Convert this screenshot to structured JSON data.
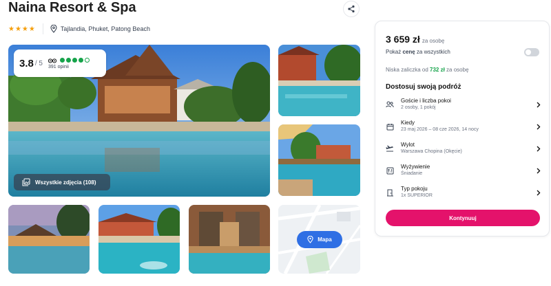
{
  "hotel": {
    "name": "Naina Resort & Spa",
    "stars": 4,
    "location": "Tajlandia, Phuket, Patong Beach"
  },
  "icons": {
    "share": "share-icon",
    "location": "map-pin-icon",
    "gallery": "gallery-icon",
    "map_pin": "map-pin-icon",
    "guests": "guests-icon",
    "calendar": "calendar-icon",
    "plane": "plane-icon",
    "food": "meal-icon",
    "room": "door-icon",
    "chevron": "chevron-right-icon"
  },
  "rating": {
    "score": "3.8",
    "of": "/ 5",
    "dots_filled": 4,
    "dots_total": 5,
    "reviews": "391 opinii"
  },
  "gallery": {
    "all_photos_label": "Wszystkie zdjęcia (108)",
    "map_label": "Mapa"
  },
  "booking": {
    "price": "3 659 zł",
    "per_person": "za osobę",
    "show_total_prefix": "Pokaż ",
    "show_total_bold": "cenę",
    "show_total_suffix": " za wszystkich",
    "deposit_prefix": "Niska zaliczka od ",
    "deposit_amount": "732 zł",
    "deposit_suffix": " za osobę",
    "section_title": "Dostosuj swoją podróż",
    "options": [
      {
        "label": "Goście i liczba pokoi",
        "value": "2 osoby, 1 pokój"
      },
      {
        "label": "Kiedy",
        "value": "23 maj 2026 – 08 cze 2026, 14 nocy"
      },
      {
        "label": "Wylot",
        "value": "Warszawa Chopina (Okęcie)"
      },
      {
        "label": "Wyżywienie",
        "value": "Śniadanie"
      },
      {
        "label": "Typ pokoju",
        "value": "1x SUPERIOR"
      }
    ],
    "continue_label": "Kontynuuj"
  },
  "colors": {
    "accent": "#e4126b",
    "rating_green": "#16a34a",
    "map_button": "#2f6fe4",
    "stars": "#f59e0b"
  }
}
